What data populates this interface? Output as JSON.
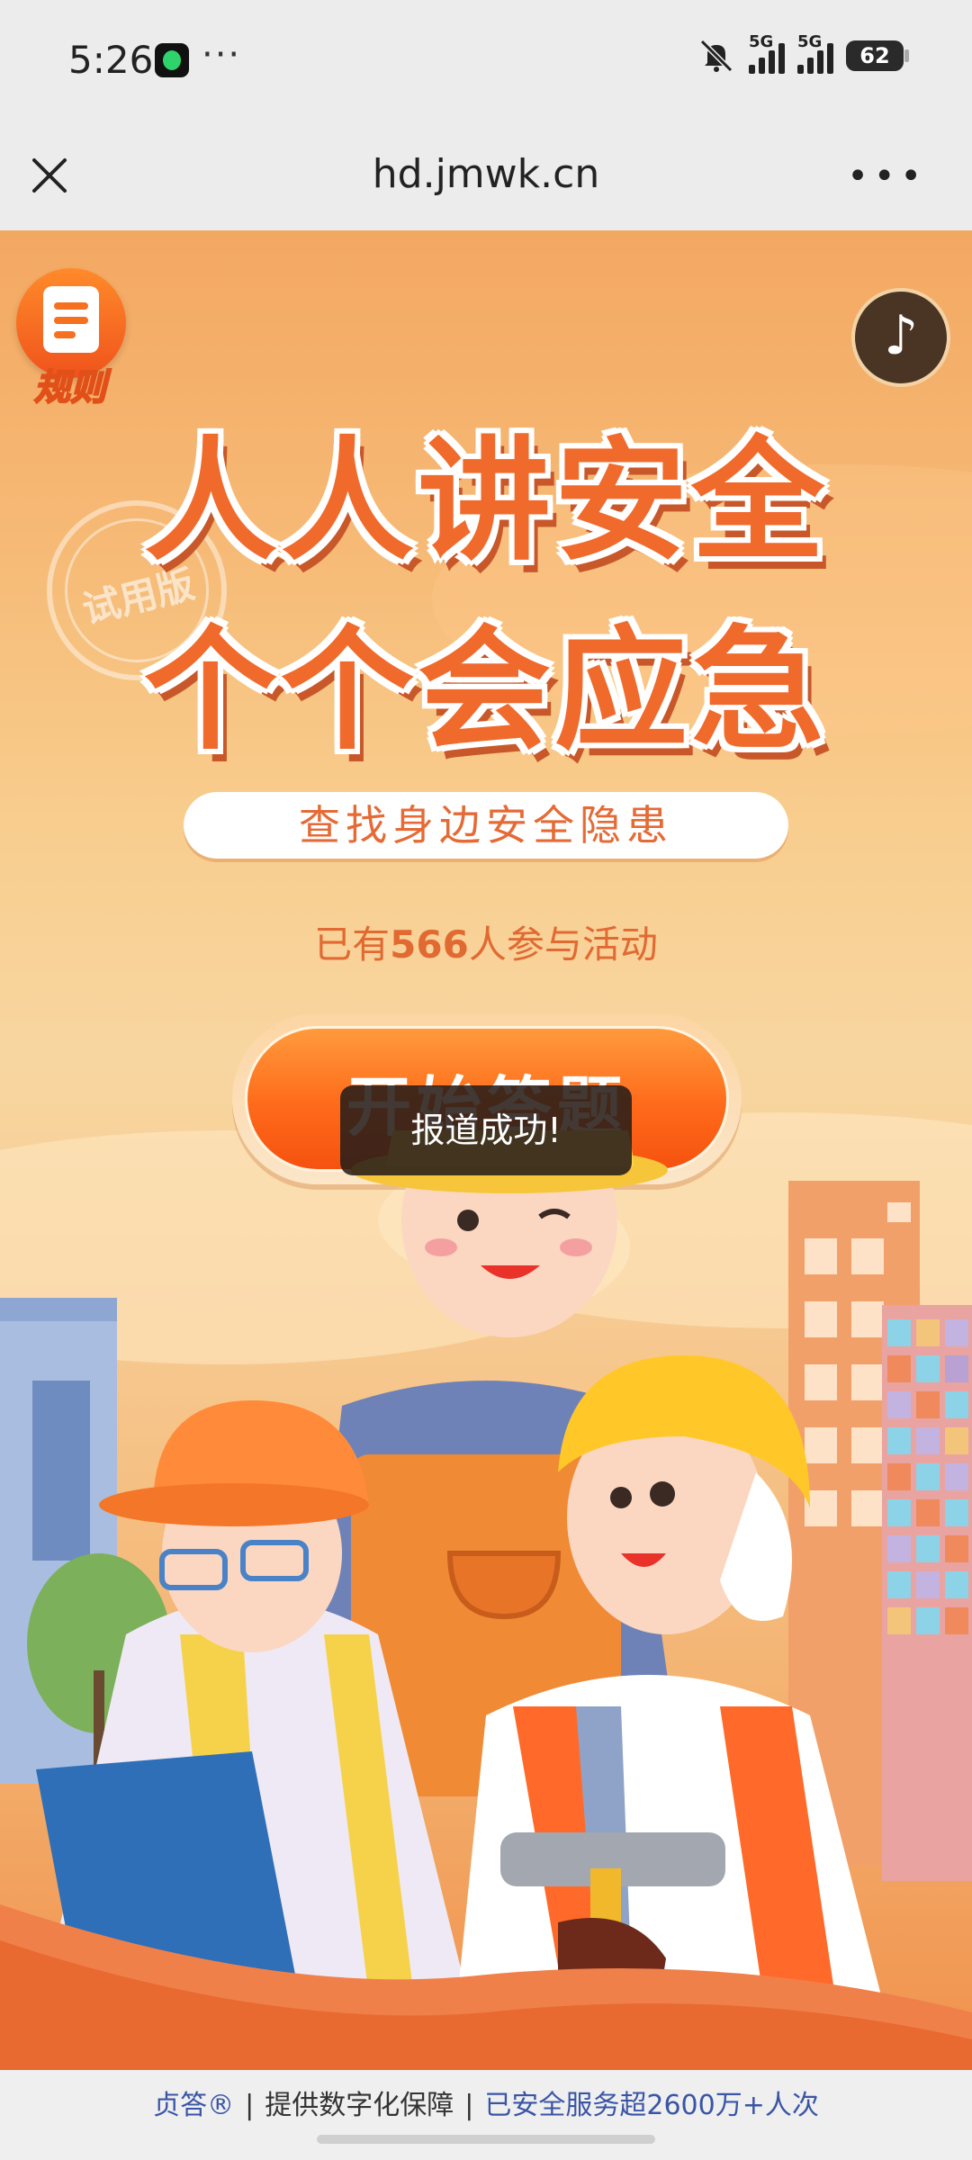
{
  "status_bar": {
    "time": "5:26",
    "more": "···",
    "network1": "5G",
    "network2": "5G",
    "battery": "62"
  },
  "nav": {
    "url": "hd.jmwk.cn",
    "more": "•••"
  },
  "page": {
    "rules_label": "规则",
    "music_icon": "music-note-icon",
    "stamp_text": "试用版",
    "headline_line1": "人人讲安全",
    "headline_line2": "个个会应急",
    "subtitle": "查找身边安全隐患",
    "participants_prefix": "已有",
    "participants_count": "566",
    "participants_suffix": "人参与活动",
    "start_button": "开始答题",
    "toast": "报道成功!"
  },
  "footer": {
    "brand": "贞答®",
    "sep": "|",
    "middle": "提供数字化保障",
    "right": "已安全服务超2600万+人次"
  },
  "colors": {
    "accent": "#f06a2c",
    "progress": "#1bbf60",
    "footer_link": "#3a55a6"
  }
}
